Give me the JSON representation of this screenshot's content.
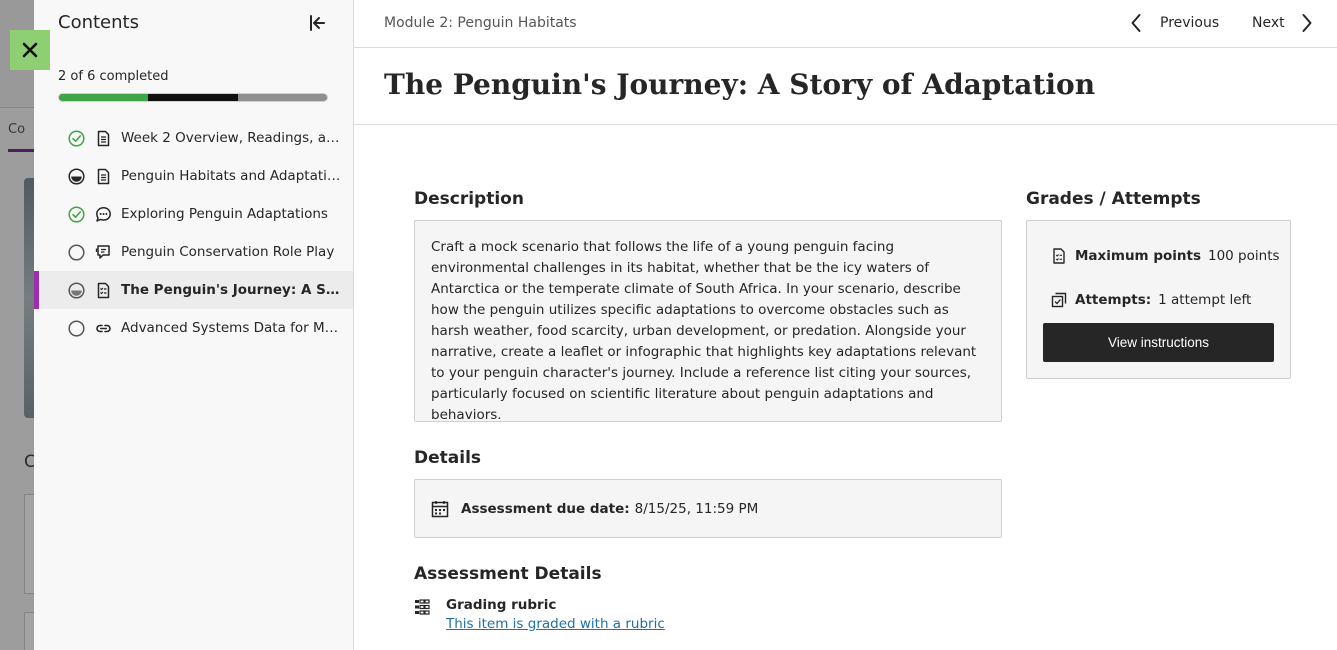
{
  "sidebar": {
    "title": "Contents",
    "progress_text": "2 of 6 completed",
    "progress": {
      "completed": 2,
      "in_progress": 2,
      "total": 6
    },
    "items": [
      {
        "label": "Week 2 Overview, Readings, and ...",
        "status": "complete",
        "type": "document"
      },
      {
        "label": "Penguin Habitats and Adaptations",
        "status": "in-progress",
        "type": "document"
      },
      {
        "label": "Exploring Penguin Adaptations",
        "status": "complete",
        "type": "discussion"
      },
      {
        "label": "Penguin Conservation Role Play",
        "status": "not-started",
        "type": "role-play"
      },
      {
        "label": "The Penguin's Journey: A Story ...",
        "status": "in-progress",
        "type": "assessment",
        "active": true
      },
      {
        "label": "Advanced Systems Data for Map...",
        "status": "not-started",
        "type": "link"
      }
    ]
  },
  "header": {
    "breadcrumb": "Module 2: Penguin Habitats",
    "previous_label": "Previous",
    "next_label": "Next"
  },
  "main": {
    "title": "The Penguin's Journey: A Story of Adaptation",
    "description_heading": "Description",
    "description": "Craft a mock scenario that follows the life of a young penguin facing environmental challenges in its habitat, whether that be the icy waters of Antarctica or the temperate climate of South Africa. In your scenario, describe how the penguin utilizes specific adaptations to overcome obstacles such as harsh weather, food scarcity, urban development, or predation. Alongside your narrative, create a leaflet or infographic that highlights key adaptations relevant to your penguin character's journey. Include a reference list citing your sources, particularly focused on scientific literature about penguin adaptations and behaviors.",
    "details_heading": "Details",
    "due_label": "Assessment due date:",
    "due_value": "8/15/25, 11:59 PM",
    "assessment_details_heading": "Assessment Details",
    "rubric_title": "Grading rubric",
    "rubric_link": "This item is graded with a rubric"
  },
  "grades": {
    "heading": "Grades / Attempts",
    "max_points_label": "Maximum points",
    "max_points_value": "100 points",
    "attempts_label": "Attempts:",
    "attempts_value": "1 attempt left",
    "view_instructions_label": "View instructions"
  },
  "colors": {
    "accent": "#9b2fae",
    "complete": "#3fa548",
    "close_button": "#8fcf74",
    "link": "#1f6fa8"
  }
}
